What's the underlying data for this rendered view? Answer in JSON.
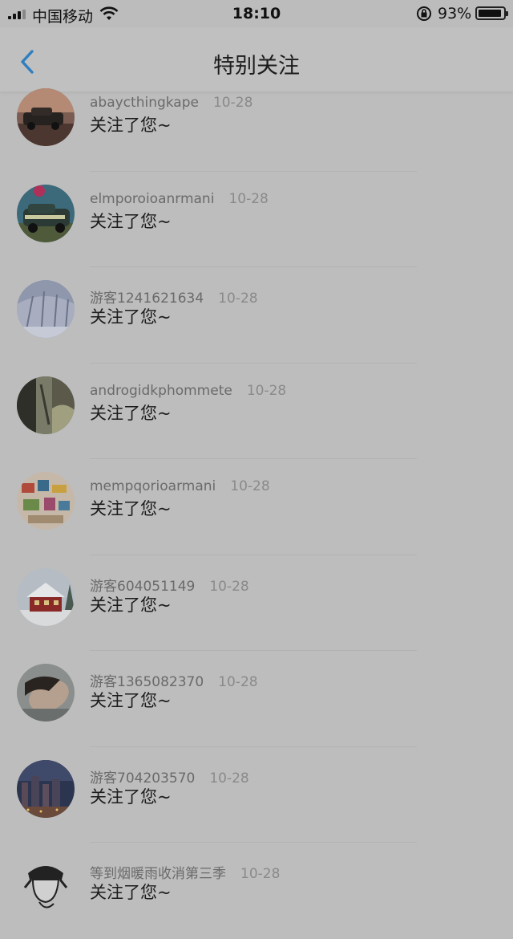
{
  "status_bar": {
    "carrier": "中国移动",
    "time": "18:10",
    "battery_percent": "93%",
    "battery_level": 0.93
  },
  "nav": {
    "title": "特别关注",
    "back_icon": "chevron-left-icon"
  },
  "items": [
    {
      "name": "abaycthingkape",
      "date": "10-28",
      "message": "关注了您~"
    },
    {
      "name": "elmporoioanrmani",
      "date": "10-28",
      "message": "关注了您~"
    },
    {
      "name": "游客1241621634",
      "date": "10-28",
      "message": "关注了您~"
    },
    {
      "name": "androgidkphommete",
      "date": "10-28",
      "message": "关注了您~"
    },
    {
      "name": "mempqorioarmani",
      "date": "10-28",
      "message": "关注了您~"
    },
    {
      "name": "游客604051149",
      "date": "10-28",
      "message": "关注了您~"
    },
    {
      "name": "游客1365082370",
      "date": "10-28",
      "message": "关注了您~"
    },
    {
      "name": "游客704203570",
      "date": "10-28",
      "message": "关注了您~"
    },
    {
      "name": "等到烟暖雨收消第三季",
      "date": "10-28",
      "message": "关注了您~"
    }
  ],
  "colors": {
    "accent": "#2f7fc0",
    "background": "#bdbdbd"
  }
}
